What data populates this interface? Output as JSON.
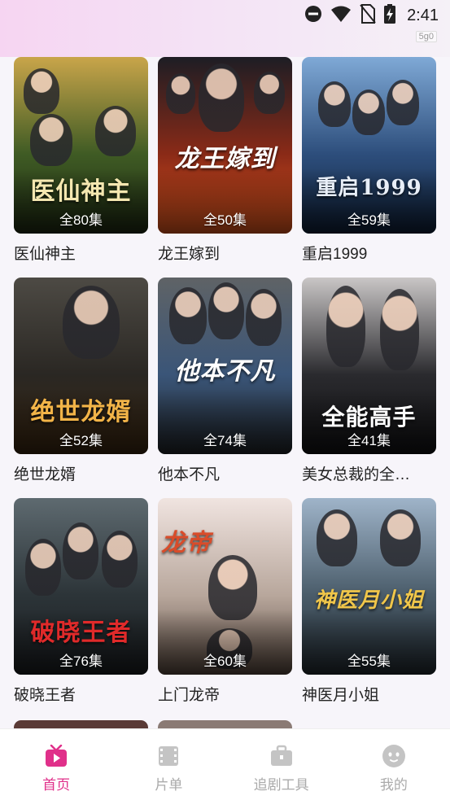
{
  "status_bar": {
    "time": "2:41",
    "network_tag": "5g0",
    "icons": [
      "dnd-icon",
      "wifi-icon",
      "no-sim-icon",
      "battery-charging-icon"
    ]
  },
  "dramas": [
    {
      "title": "医仙神主",
      "episodes": "全80集",
      "poster_text": "医仙神主",
      "colors": [
        "#c9a54a",
        "#3f5b24",
        "#1e2a12"
      ],
      "text_color": "#f4e7b0"
    },
    {
      "title": "龙王嫁到",
      "episodes": "全50集",
      "poster_text": "龙王嫁到",
      "colors": [
        "#1d1d24",
        "#8a2a17",
        "#e2571e"
      ],
      "text_color": "#ffffff"
    },
    {
      "title": "重启1999",
      "episodes": "全59集",
      "poster_text": "重启1999",
      "colors": [
        "#7fa9d6",
        "#2d4e7c",
        "#0f2038"
      ],
      "text_color": "#e8eef7"
    },
    {
      "title": "绝世龙婿",
      "episodes": "全52集",
      "poster_text": "绝世龙婿",
      "colors": [
        "#4d4a44",
        "#2a2723",
        "#3a2610"
      ],
      "text_color": "#f2b448"
    },
    {
      "title": "他本不凡",
      "episodes": "全74集",
      "poster_text": "他本不凡",
      "colors": [
        "#5f6366",
        "#3a5578",
        "#202428"
      ],
      "text_color": "#ffffff"
    },
    {
      "title": "美女总裁的全…",
      "episodes": "全41集",
      "poster_text": "全能高手",
      "colors": [
        "#c9c6c6",
        "#2a2a2e",
        "#111113"
      ],
      "text_color": "#ffffff"
    },
    {
      "title": "破晓王者",
      "episodes": "全76集",
      "poster_text": "破晓王者",
      "colors": [
        "#5e6a70",
        "#2c3438",
        "#1a1d20"
      ],
      "text_color": "#e02a2a"
    },
    {
      "title": "上门龙帝",
      "episodes": "全60集",
      "poster_text": "龙帝",
      "colors": [
        "#f0e4e0",
        "#b8a79c",
        "#5a4a40"
      ],
      "text_color": "#d94c2a"
    },
    {
      "title": "神医月小姐",
      "episodes": "全55集",
      "poster_text": "神医月小姐",
      "colors": [
        "#9fb4c9",
        "#4a5c6a",
        "#222a30"
      ],
      "text_color": "#f0c64a"
    }
  ],
  "partial_row_colors": [
    "#5a3a36",
    "#8a7a74"
  ],
  "tabs": [
    {
      "label": "首页",
      "icon": "tv-icon",
      "active": true
    },
    {
      "label": "片单",
      "icon": "film-icon",
      "active": false
    },
    {
      "label": "追剧工具",
      "icon": "toolbox-icon",
      "active": false
    },
    {
      "label": "我的",
      "icon": "profile-icon",
      "active": false
    }
  ],
  "colors": {
    "accent": "#e0308a",
    "inactive": "#bbbbbb"
  }
}
